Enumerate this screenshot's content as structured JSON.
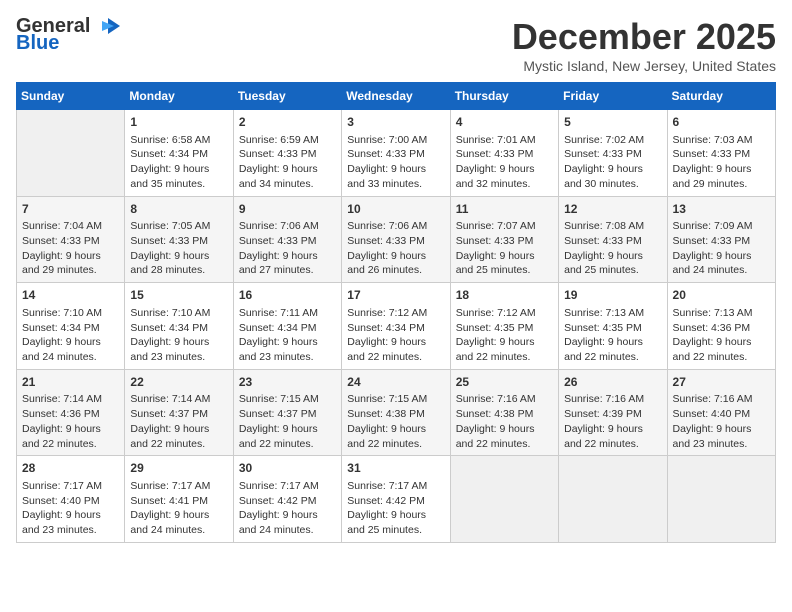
{
  "logo": {
    "general": "General",
    "blue": "Blue"
  },
  "title": "December 2025",
  "subtitle": "Mystic Island, New Jersey, United States",
  "days_of_week": [
    "Sunday",
    "Monday",
    "Tuesday",
    "Wednesday",
    "Thursday",
    "Friday",
    "Saturday"
  ],
  "weeks": [
    [
      {
        "day": "",
        "sunrise": "",
        "sunset": "",
        "daylight": ""
      },
      {
        "day": "1",
        "sunrise": "Sunrise: 6:58 AM",
        "sunset": "Sunset: 4:34 PM",
        "daylight": "Daylight: 9 hours and 35 minutes."
      },
      {
        "day": "2",
        "sunrise": "Sunrise: 6:59 AM",
        "sunset": "Sunset: 4:33 PM",
        "daylight": "Daylight: 9 hours and 34 minutes."
      },
      {
        "day": "3",
        "sunrise": "Sunrise: 7:00 AM",
        "sunset": "Sunset: 4:33 PM",
        "daylight": "Daylight: 9 hours and 33 minutes."
      },
      {
        "day": "4",
        "sunrise": "Sunrise: 7:01 AM",
        "sunset": "Sunset: 4:33 PM",
        "daylight": "Daylight: 9 hours and 32 minutes."
      },
      {
        "day": "5",
        "sunrise": "Sunrise: 7:02 AM",
        "sunset": "Sunset: 4:33 PM",
        "daylight": "Daylight: 9 hours and 30 minutes."
      },
      {
        "day": "6",
        "sunrise": "Sunrise: 7:03 AM",
        "sunset": "Sunset: 4:33 PM",
        "daylight": "Daylight: 9 hours and 29 minutes."
      }
    ],
    [
      {
        "day": "7",
        "sunrise": "Sunrise: 7:04 AM",
        "sunset": "Sunset: 4:33 PM",
        "daylight": "Daylight: 9 hours and 29 minutes."
      },
      {
        "day": "8",
        "sunrise": "Sunrise: 7:05 AM",
        "sunset": "Sunset: 4:33 PM",
        "daylight": "Daylight: 9 hours and 28 minutes."
      },
      {
        "day": "9",
        "sunrise": "Sunrise: 7:06 AM",
        "sunset": "Sunset: 4:33 PM",
        "daylight": "Daylight: 9 hours and 27 minutes."
      },
      {
        "day": "10",
        "sunrise": "Sunrise: 7:06 AM",
        "sunset": "Sunset: 4:33 PM",
        "daylight": "Daylight: 9 hours and 26 minutes."
      },
      {
        "day": "11",
        "sunrise": "Sunrise: 7:07 AM",
        "sunset": "Sunset: 4:33 PM",
        "daylight": "Daylight: 9 hours and 25 minutes."
      },
      {
        "day": "12",
        "sunrise": "Sunrise: 7:08 AM",
        "sunset": "Sunset: 4:33 PM",
        "daylight": "Daylight: 9 hours and 25 minutes."
      },
      {
        "day": "13",
        "sunrise": "Sunrise: 7:09 AM",
        "sunset": "Sunset: 4:33 PM",
        "daylight": "Daylight: 9 hours and 24 minutes."
      }
    ],
    [
      {
        "day": "14",
        "sunrise": "Sunrise: 7:10 AM",
        "sunset": "Sunset: 4:34 PM",
        "daylight": "Daylight: 9 hours and 24 minutes."
      },
      {
        "day": "15",
        "sunrise": "Sunrise: 7:10 AM",
        "sunset": "Sunset: 4:34 PM",
        "daylight": "Daylight: 9 hours and 23 minutes."
      },
      {
        "day": "16",
        "sunrise": "Sunrise: 7:11 AM",
        "sunset": "Sunset: 4:34 PM",
        "daylight": "Daylight: 9 hours and 23 minutes."
      },
      {
        "day": "17",
        "sunrise": "Sunrise: 7:12 AM",
        "sunset": "Sunset: 4:34 PM",
        "daylight": "Daylight: 9 hours and 22 minutes."
      },
      {
        "day": "18",
        "sunrise": "Sunrise: 7:12 AM",
        "sunset": "Sunset: 4:35 PM",
        "daylight": "Daylight: 9 hours and 22 minutes."
      },
      {
        "day": "19",
        "sunrise": "Sunrise: 7:13 AM",
        "sunset": "Sunset: 4:35 PM",
        "daylight": "Daylight: 9 hours and 22 minutes."
      },
      {
        "day": "20",
        "sunrise": "Sunrise: 7:13 AM",
        "sunset": "Sunset: 4:36 PM",
        "daylight": "Daylight: 9 hours and 22 minutes."
      }
    ],
    [
      {
        "day": "21",
        "sunrise": "Sunrise: 7:14 AM",
        "sunset": "Sunset: 4:36 PM",
        "daylight": "Daylight: 9 hours and 22 minutes."
      },
      {
        "day": "22",
        "sunrise": "Sunrise: 7:14 AM",
        "sunset": "Sunset: 4:37 PM",
        "daylight": "Daylight: 9 hours and 22 minutes."
      },
      {
        "day": "23",
        "sunrise": "Sunrise: 7:15 AM",
        "sunset": "Sunset: 4:37 PM",
        "daylight": "Daylight: 9 hours and 22 minutes."
      },
      {
        "day": "24",
        "sunrise": "Sunrise: 7:15 AM",
        "sunset": "Sunset: 4:38 PM",
        "daylight": "Daylight: 9 hours and 22 minutes."
      },
      {
        "day": "25",
        "sunrise": "Sunrise: 7:16 AM",
        "sunset": "Sunset: 4:38 PM",
        "daylight": "Daylight: 9 hours and 22 minutes."
      },
      {
        "day": "26",
        "sunrise": "Sunrise: 7:16 AM",
        "sunset": "Sunset: 4:39 PM",
        "daylight": "Daylight: 9 hours and 22 minutes."
      },
      {
        "day": "27",
        "sunrise": "Sunrise: 7:16 AM",
        "sunset": "Sunset: 4:40 PM",
        "daylight": "Daylight: 9 hours and 23 minutes."
      }
    ],
    [
      {
        "day": "28",
        "sunrise": "Sunrise: 7:17 AM",
        "sunset": "Sunset: 4:40 PM",
        "daylight": "Daylight: 9 hours and 23 minutes."
      },
      {
        "day": "29",
        "sunrise": "Sunrise: 7:17 AM",
        "sunset": "Sunset: 4:41 PM",
        "daylight": "Daylight: 9 hours and 24 minutes."
      },
      {
        "day": "30",
        "sunrise": "Sunrise: 7:17 AM",
        "sunset": "Sunset: 4:42 PM",
        "daylight": "Daylight: 9 hours and 24 minutes."
      },
      {
        "day": "31",
        "sunrise": "Sunrise: 7:17 AM",
        "sunset": "Sunset: 4:42 PM",
        "daylight": "Daylight: 9 hours and 25 minutes."
      },
      {
        "day": "",
        "sunrise": "",
        "sunset": "",
        "daylight": ""
      },
      {
        "day": "",
        "sunrise": "",
        "sunset": "",
        "daylight": ""
      },
      {
        "day": "",
        "sunrise": "",
        "sunset": "",
        "daylight": ""
      }
    ]
  ]
}
